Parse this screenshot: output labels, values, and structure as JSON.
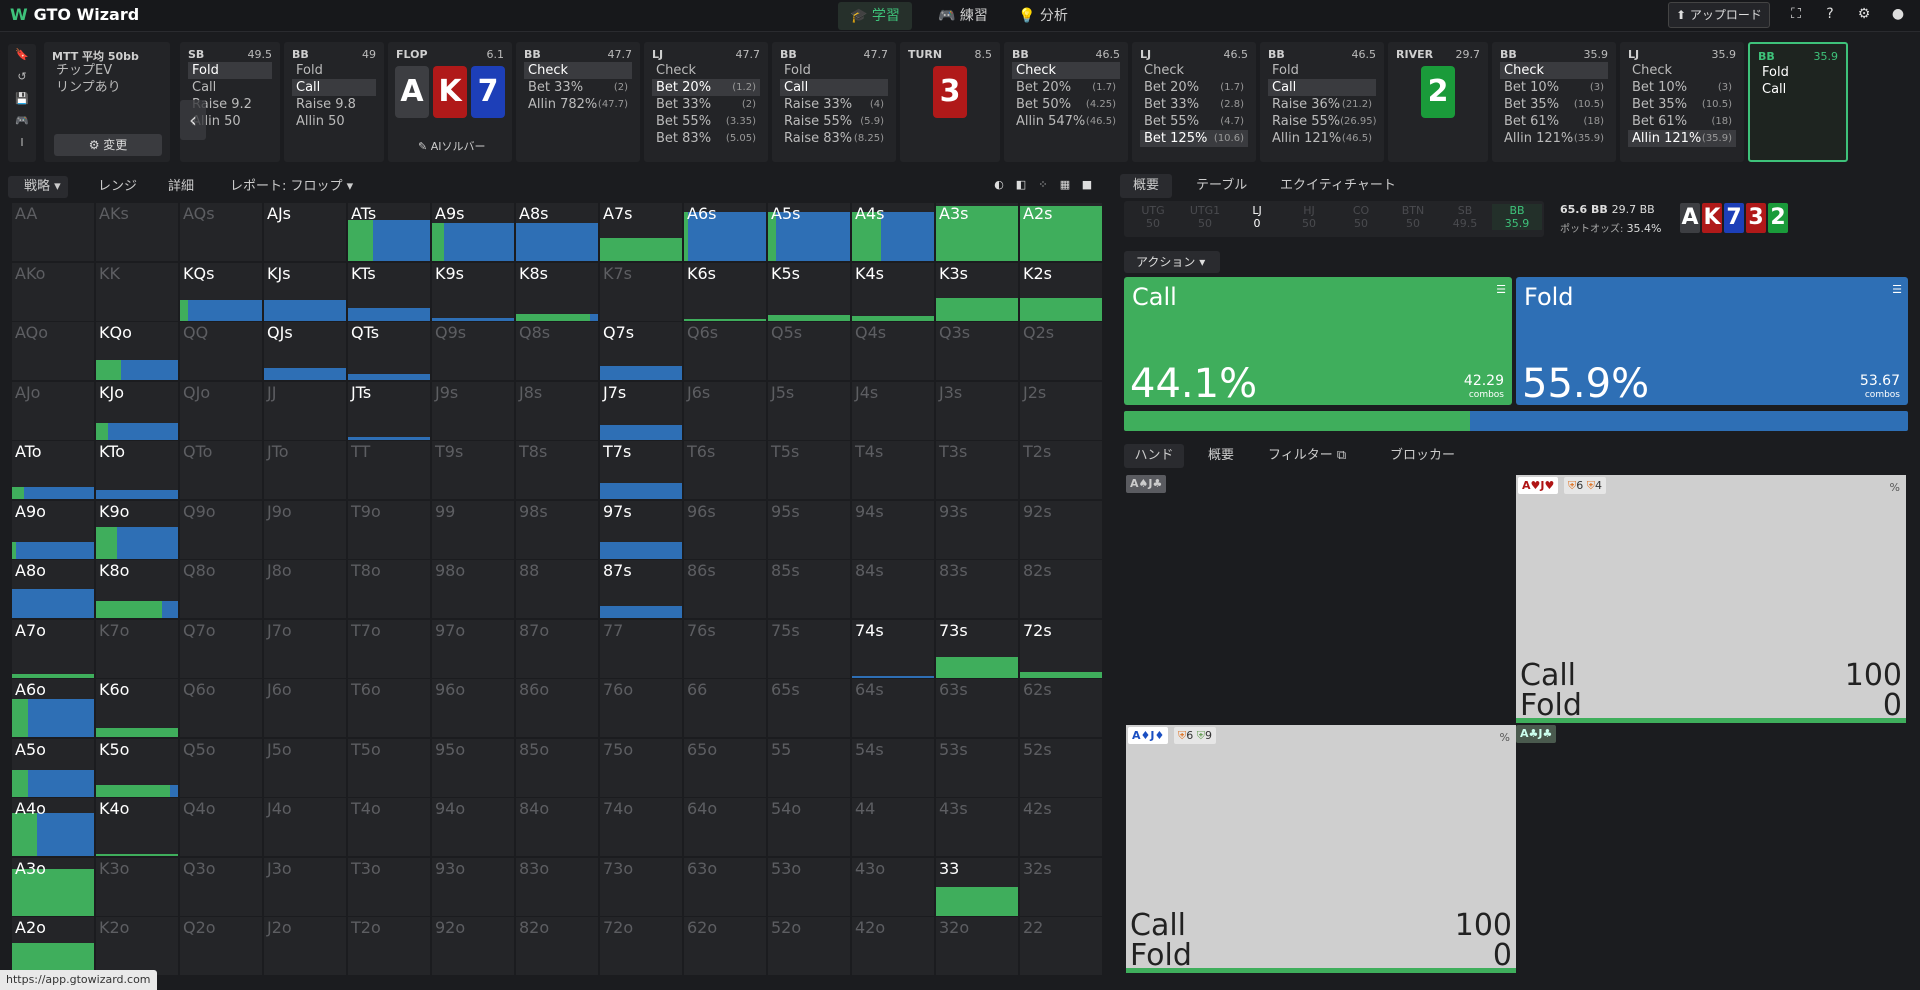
{
  "app": {
    "name": "GTO Wizard",
    "logo_letter": "W"
  },
  "nav": [
    {
      "icon": "graduation-cap-icon",
      "label": "学習",
      "active": true
    },
    {
      "icon": "gamepad-icon",
      "label": "練習",
      "active": false
    },
    {
      "icon": "lightbulb-icon",
      "label": "分析",
      "active": false
    }
  ],
  "topright": {
    "upload": "アップロード"
  },
  "url": "https://app.gtowizard.com",
  "tree": {
    "settings": {
      "title": "MTT 平均 50bb",
      "line1": "チップEV",
      "line2": "リンプあり",
      "change": "変更"
    },
    "columns": [
      {
        "pos": "SB",
        "size": "49.5",
        "actions": [
          {
            "l": "Fold",
            "sel": true
          },
          {
            "l": "Call"
          },
          {
            "l": "Raise 9.2"
          },
          {
            "l": "Allin 50"
          }
        ]
      },
      {
        "pos": "BB",
        "size": "49",
        "actions": [
          {
            "l": "Fold"
          },
          {
            "l": "Call",
            "sel": true
          },
          {
            "l": "Raise 9.8"
          },
          {
            "l": "Allin 50"
          }
        ]
      },
      {
        "pos": "FLOP",
        "size": "6.1",
        "cards": [
          "A",
          "K",
          "7"
        ],
        "ai": "AIソルバー"
      },
      {
        "pos": "BB",
        "size": "47.7",
        "actions": [
          {
            "l": "Check",
            "sel": true
          },
          {
            "l": "Bet 33%",
            "n": "(2)"
          },
          {
            "l": "Allin 782%",
            "n": "(47.7)"
          }
        ]
      },
      {
        "pos": "LJ",
        "size": "47.7",
        "actions": [
          {
            "l": "Check"
          },
          {
            "l": "Bet 20%",
            "n": "(1.2)",
            "sel": true
          },
          {
            "l": "Bet 33%",
            "n": "(2)"
          },
          {
            "l": "Bet 55%",
            "n": "(3.35)"
          },
          {
            "l": "Bet 83%",
            "n": "(5.05)"
          }
        ]
      },
      {
        "pos": "BB",
        "size": "47.7",
        "actions": [
          {
            "l": "Fold"
          },
          {
            "l": "Call",
            "sel": true
          },
          {
            "l": "Raise 33%",
            "n": "(4)"
          },
          {
            "l": "Raise 55%",
            "n": "(5.9)"
          },
          {
            "l": "Raise 83%",
            "n": "(8.25)"
          }
        ]
      },
      {
        "pos": "TURN",
        "size": "8.5",
        "cards": [
          "3"
        ]
      },
      {
        "pos": "BB",
        "size": "46.5",
        "actions": [
          {
            "l": "Check",
            "sel": true
          },
          {
            "l": "Bet 20%",
            "n": "(1.7)"
          },
          {
            "l": "Bet 50%",
            "n": "(4.25)"
          },
          {
            "l": "Allin 547%",
            "n": "(46.5)"
          }
        ]
      },
      {
        "pos": "LJ",
        "size": "46.5",
        "actions": [
          {
            "l": "Check"
          },
          {
            "l": "Bet 20%",
            "n": "(1.7)"
          },
          {
            "l": "Bet 33%",
            "n": "(2.8)"
          },
          {
            "l": "Bet 55%",
            "n": "(4.7)"
          },
          {
            "l": "Bet 125%",
            "n": "(10.6)",
            "sel": true
          }
        ]
      },
      {
        "pos": "BB",
        "size": "46.5",
        "actions": [
          {
            "l": "Fold"
          },
          {
            "l": "Call",
            "sel": true
          },
          {
            "l": "Raise 36%",
            "n": "(21.2)"
          },
          {
            "l": "Raise 55%",
            "n": "(26.95)"
          },
          {
            "l": "Allin 121%",
            "n": "(46.5)"
          }
        ]
      },
      {
        "pos": "RIVER",
        "size": "29.7",
        "cards": [
          "2"
        ]
      },
      {
        "pos": "BB",
        "size": "35.9",
        "actions": [
          {
            "l": "Check",
            "sel": true
          },
          {
            "l": "Bet 10%",
            "n": "(3)"
          },
          {
            "l": "Bet 35%",
            "n": "(10.5)"
          },
          {
            "l": "Bet 61%",
            "n": "(18)"
          },
          {
            "l": "Allin 121%",
            "n": "(35.9)"
          }
        ]
      },
      {
        "pos": "LJ",
        "size": "35.9",
        "actions": [
          {
            "l": "Check"
          },
          {
            "l": "Bet 10%",
            "n": "(3)"
          },
          {
            "l": "Bet 35%",
            "n": "(10.5)"
          },
          {
            "l": "Bet 61%",
            "n": "(18)"
          },
          {
            "l": "Allin 121%",
            "n": "(35.9)",
            "sel": true
          }
        ]
      },
      {
        "pos": "BB",
        "size": "35.9",
        "actions": [
          {
            "l": "Fold"
          },
          {
            "l": "Call"
          }
        ],
        "current": true
      }
    ]
  },
  "left_tabs": {
    "strategy": "戦略",
    "range": "レンジ",
    "detail": "詳細",
    "report": "レポート: フロップ"
  },
  "right_tabs": {
    "overview": "概要",
    "table": "テーブル",
    "equity": "エクイティチャート"
  },
  "positions": [
    {
      "p": "UTG",
      "s": "50"
    },
    {
      "p": "UTG1",
      "s": "50"
    },
    {
      "p": "LJ",
      "s": "0",
      "on": true
    },
    {
      "p": "HJ",
      "s": "50"
    },
    {
      "p": "CO",
      "s": "50"
    },
    {
      "p": "BTN",
      "s": "50"
    },
    {
      "p": "SB",
      "s": "49.5"
    },
    {
      "p": "BB",
      "s": "35.9",
      "bb": true
    }
  ],
  "pot": {
    "a": "65.6 BB",
    "b": "29.7 BB",
    "label": "ポットオッズ:",
    "odds": "35.4%"
  },
  "board": [
    "A",
    "K",
    "7",
    "3",
    "2"
  ],
  "action_dd": "アクション",
  "actions": [
    {
      "name": "Call",
      "pct": "44.1%",
      "combos": "42.29",
      "unit": "combos",
      "color": "#3fae5c",
      "value": 0.441
    },
    {
      "name": "Fold",
      "pct": "55.9%",
      "combos": "53.67",
      "unit": "combos",
      "color": "#2e6fb5",
      "value": 0.559
    }
  ],
  "hand_tabs": {
    "hands": "ハンド",
    "overview": "概要",
    "filter": "フィルター",
    "blocker": "ブロッカー"
  },
  "hands": [
    {
      "label": "A♠J♣",
      "combo_label": ""
    },
    {
      "label": "A♥J♥",
      "b1": "6",
      "b2": "4",
      "pct": "%",
      "call": "Call",
      "call_v": "100",
      "fold": "Fold",
      "fold_v": "0"
    },
    {
      "label": "A♦J♦",
      "b1": "6",
      "b2": "9",
      "pct": "%",
      "call": "Call",
      "call_v": "100",
      "fold": "Fold",
      "fold_v": "0"
    },
    {
      "label": "A♣J♣",
      "combo_label": ""
    }
  ],
  "grid": {
    "rows": [
      [
        "AA",
        "AKs",
        "AQs",
        "AJs",
        "ATs",
        "A9s",
        "A8s",
        "A7s",
        "A6s",
        "A5s",
        "A4s",
        "A3s",
        "A2s"
      ],
      [
        "AKo",
        "KK",
        "KQs",
        "KJs",
        "KTs",
        "K9s",
        "K8s",
        "K7s",
        "K6s",
        "K5s",
        "K4s",
        "K3s",
        "K2s"
      ],
      [
        "AQo",
        "KQo",
        "QQ",
        "QJs",
        "QTs",
        "Q9s",
        "Q8s",
        "Q7s",
        "Q6s",
        "Q5s",
        "Q4s",
        "Q3s",
        "Q2s"
      ],
      [
        "AJo",
        "KJo",
        "QJo",
        "JJ",
        "JTs",
        "J9s",
        "J8s",
        "J7s",
        "J6s",
        "J5s",
        "J4s",
        "J3s",
        "J2s"
      ],
      [
        "ATo",
        "KTo",
        "QTo",
        "JTo",
        "TT",
        "T9s",
        "T8s",
        "T7s",
        "T6s",
        "T5s",
        "T4s",
        "T3s",
        "T2s"
      ],
      [
        "A9o",
        "K9o",
        "Q9o",
        "J9o",
        "T9o",
        "99",
        "98s",
        "97s",
        "96s",
        "95s",
        "94s",
        "93s",
        "92s"
      ],
      [
        "A8o",
        "K8o",
        "Q8o",
        "J8o",
        "T8o",
        "98o",
        "88",
        "87s",
        "86s",
        "85s",
        "84s",
        "83s",
        "82s"
      ],
      [
        "A7o",
        "K7o",
        "Q7o",
        "J7o",
        "T7o",
        "97o",
        "87o",
        "77",
        "76s",
        "75s",
        "74s",
        "73s",
        "72s"
      ],
      [
        "A6o",
        "K6o",
        "Q6o",
        "J6o",
        "T6o",
        "96o",
        "86o",
        "76o",
        "66",
        "65s",
        "64s",
        "63s",
        "62s"
      ],
      [
        "A5o",
        "K5o",
        "Q5o",
        "J5o",
        "T5o",
        "95o",
        "85o",
        "75o",
        "65o",
        "55",
        "54s",
        "53s",
        "52s"
      ],
      [
        "A4o",
        "K4o",
        "Q4o",
        "J4o",
        "T4o",
        "94o",
        "84o",
        "74o",
        "64o",
        "54o",
        "44",
        "43s",
        "42s"
      ],
      [
        "A3o",
        "K3o",
        "Q3o",
        "J3o",
        "T3o",
        "93o",
        "83o",
        "73o",
        "63o",
        "53o",
        "43o",
        "33",
        "32s"
      ],
      [
        "A2o",
        "K2o",
        "Q2o",
        "J2o",
        "T2o",
        "92o",
        "82o",
        "72o",
        "62o",
        "52o",
        "42o",
        "32o",
        "22"
      ]
    ],
    "strategy": {
      "AJs": [
        1,
        0,
        0
      ],
      "ATs": [
        0.7,
        0.3,
        0.7
      ],
      "A9s": [
        0.65,
        0.15,
        0.85
      ],
      "A8s": [
        0.65,
        0,
        1
      ],
      "A7s": [
        0.4,
        1,
        0
      ],
      "A6s": [
        0.85,
        0.05,
        0.95
      ],
      "A5s": [
        0.85,
        0.1,
        0.9
      ],
      "A4s": [
        0.85,
        0.35,
        0.65
      ],
      "A3s": [
        0.95,
        1,
        0
      ],
      "A2s": [
        0.95,
        1,
        0
      ],
      "KQs": [
        0.35,
        0.1,
        0.9
      ],
      "KJs": [
        0.35,
        0,
        1
      ],
      "KTs": [
        0.22,
        0,
        1
      ],
      "K9s": [
        0.05,
        0,
        1
      ],
      "K8s": [
        0.12,
        0.9,
        0.1
      ],
      "K6s": [
        0.02,
        1,
        0
      ],
      "K5s": [
        0.1,
        1,
        0
      ],
      "K4s": [
        0.08,
        1,
        0
      ],
      "K3s": [
        0.38,
        1,
        0
      ],
      "K2s": [
        0.38,
        1,
        0
      ],
      "KQo": [
        0.35,
        0.3,
        0.7
      ],
      "QJs": [
        0.2,
        0,
        1
      ],
      "QTs": [
        0.1,
        0,
        1
      ],
      "Q7s": [
        0.25,
        0,
        1
      ],
      "KJo": [
        0.28,
        0.15,
        0.85
      ],
      "JTs": [
        0.05,
        0,
        1
      ],
      "J7s": [
        0.25,
        0,
        1
      ],
      "ATo": [
        0.2,
        0.15,
        0.85
      ],
      "KTo": [
        0.15,
        0,
        1
      ],
      "T7s": [
        0.28,
        0,
        1
      ],
      "A9o": [
        0.28,
        0.05,
        0.95
      ],
      "K9o": [
        0.55,
        0.25,
        0.75
      ],
      "97s": [
        0.28,
        0,
        1
      ],
      "A8o": [
        0.5,
        0,
        1
      ],
      "K8o": [
        0.3,
        0.8,
        0.2
      ],
      "87s": [
        0.2,
        0,
        1
      ],
      "A7o": [
        0.06,
        1,
        0
      ],
      "74s": [
        0.03,
        0,
        1
      ],
      "73s": [
        0.35,
        1,
        0
      ],
      "72s": [
        0.1,
        1,
        0
      ],
      "A6o": [
        0.65,
        0.2,
        0.8
      ],
      "K6o": [
        0.15,
        1,
        0
      ],
      "A5o": [
        0.45,
        0.2,
        0.8
      ],
      "K5o": [
        0.2,
        0.9,
        0.1
      ],
      "A4o": [
        0.75,
        0.3,
        0.7
      ],
      "K4o": [
        0.04,
        1,
        0
      ],
      "A3o": [
        0.8,
        1,
        0
      ],
      "33": [
        0.5,
        1,
        0
      ],
      "A2o": [
        0.55,
        1,
        0
      ]
    }
  }
}
